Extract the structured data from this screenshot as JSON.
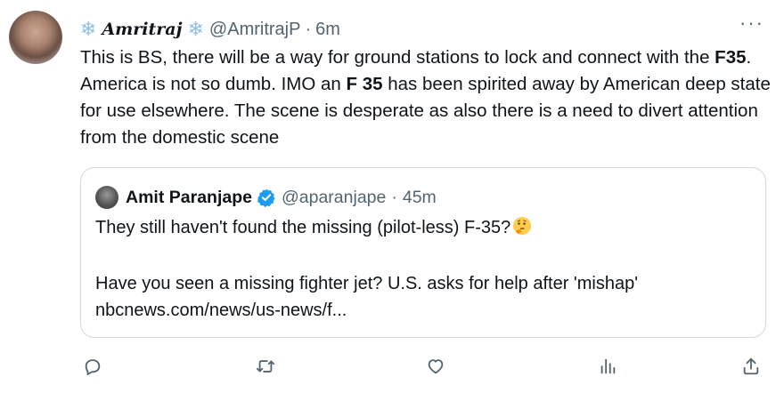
{
  "tweet": {
    "display_name": "Amritraj",
    "handle": "@AmritrajP",
    "separator": "·",
    "time": "6m",
    "more_label": "···",
    "text": {
      "p1": "This is BS, there will be a way for ground stations to lock and connect with the ",
      "b1": "F35",
      "p2": ". America is not so dumb. IMO an ",
      "b2": "F 35",
      "p3": " has been spirited away by American deep state for use elsewhere. The scene is desperate as also there is a need to divert attention from the domestic scene"
    },
    "flake_glyph": "❄"
  },
  "quote": {
    "display_name": "Amit Paranjape",
    "handle": "@aparanjape",
    "separator": "·",
    "time": "45m",
    "line1": "They still haven't found the missing (pilot-less) F-35?",
    "line2": "Have you seen a missing fighter jet? U.S. asks for help after 'mishap'",
    "line3": "nbcnews.com/news/us-news/f..."
  },
  "colors": {
    "muted": "#536471",
    "border": "#cfd9de",
    "verified": "#1d9bf0",
    "flake": "#8fbfe6"
  },
  "icons": [
    "reply-icon",
    "retweet-icon",
    "like-icon",
    "views-icon",
    "share-icon"
  ]
}
